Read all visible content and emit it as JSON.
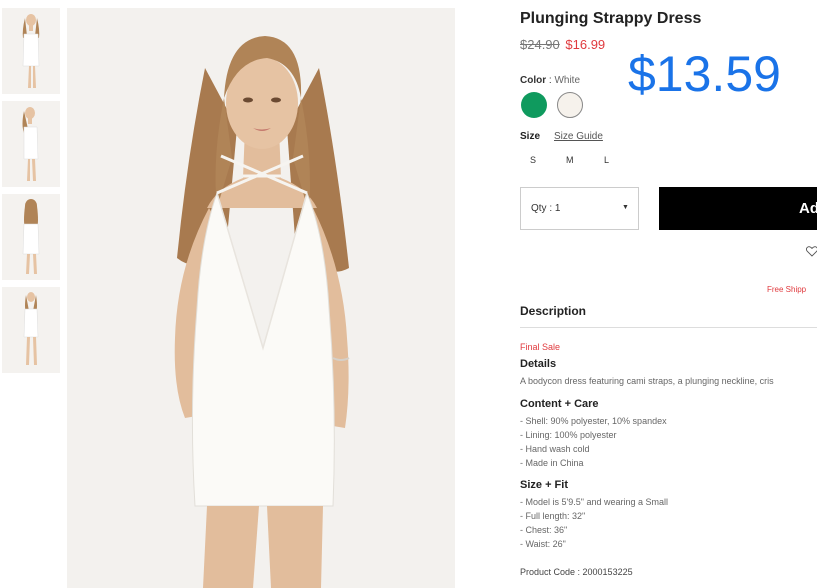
{
  "product": {
    "title": "Plunging Strappy Dress",
    "price_original": "$24.90",
    "price_sale": "$16.99",
    "price_overlay": "$13.59",
    "color_label": "Color",
    "color_separator": " : ",
    "color_selected": "White",
    "colors": [
      {
        "name": "green",
        "hex": "#0f9a5e"
      },
      {
        "name": "white",
        "hex": "#f6f2ec"
      }
    ],
    "size_label": "Size",
    "size_guide": "Size Guide",
    "sizes": [
      "S",
      "M",
      "L"
    ],
    "quantity": "Qty : 1",
    "add_button": "Ad",
    "free_shipping": "Free Shipp",
    "product_code": "Product Code : 2000153225"
  },
  "description": {
    "heading": "Description",
    "final_sale": "Final Sale",
    "details_title": "Details",
    "details_text": "A bodycon dress featuring cami straps, a plunging neckline, cris",
    "content_title": "Content + Care",
    "content_items": [
      "- Shell: 90% polyester, 10% spandex",
      "- Lining: 100% polyester",
      "- Hand wash cold",
      "- Made in China"
    ],
    "fit_title": "Size + Fit",
    "fit_items": [
      "- Model is 5'9.5\" and wearing a Small",
      "- Full length: 32\"",
      "- Chest: 36\"",
      "- Waist: 26\""
    ]
  },
  "colors": {
    "accent_blue": "#1a73e8",
    "sale_red": "#e03a3e",
    "button_black": "#000000"
  }
}
